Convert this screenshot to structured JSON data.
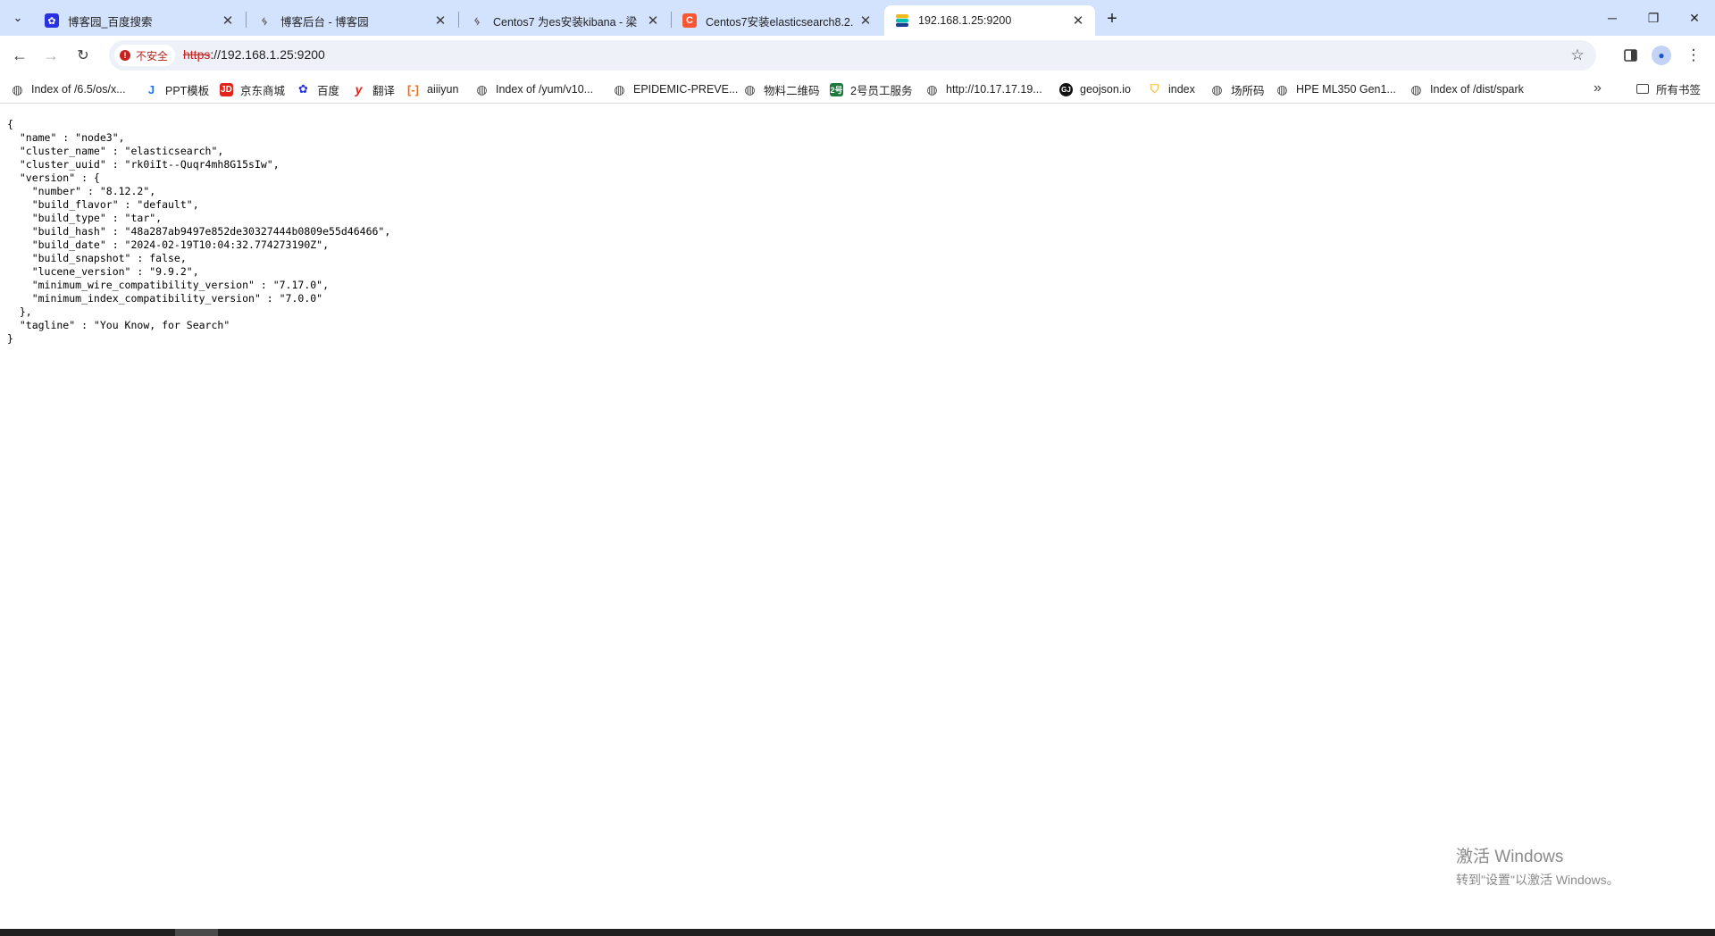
{
  "tabs": [
    {
      "title": "博客园_百度搜索",
      "icon": "baidu-paw-icon",
      "color": "#2932e1"
    },
    {
      "title": "博客后台 - 博客园",
      "icon": "cnblogs-icon",
      "color": "#555555"
    },
    {
      "title": "Centos7 为es安装kibana - 梁",
      "icon": "cnblogs-icon",
      "color": "#555555"
    },
    {
      "title": "Centos7安装elasticsearch8.2.",
      "icon": "csdn-icon",
      "color": "#fc5531"
    },
    {
      "title": "192.168.1.25:9200",
      "icon": "elastic-icon",
      "color": "#00bfb3"
    }
  ],
  "omnibox": {
    "security_label": "不安全",
    "url_scheme": "https",
    "url_rest": "://192.168.1.25:9200"
  },
  "bookmarks": [
    {
      "label": "Index of /6.5/os/x...",
      "icon": "globe-icon"
    },
    {
      "label": "PPT模板",
      "icon": "ppt-icon",
      "color": "#1677ff"
    },
    {
      "label": "京东商城",
      "icon": "jd-icon",
      "color": "#e1251b"
    },
    {
      "label": "百度",
      "icon": "baidu-paw-icon",
      "color": "#2932e1"
    },
    {
      "label": "翻译",
      "icon": "youdao-icon",
      "color": "#e1251b"
    },
    {
      "label": "aiiiyun",
      "icon": "aliyun-icon",
      "color": "#ff6a00"
    },
    {
      "label": "Index of /yum/v10...",
      "icon": "globe-icon"
    },
    {
      "label": "EPIDEMIC-PREVE...",
      "icon": "globe-icon"
    },
    {
      "label": "物料二维码",
      "icon": "globe-icon"
    },
    {
      "label": "2号员工服务",
      "icon": "two-icon",
      "color": "#1e7a3c"
    },
    {
      "label": "http://10.17.17.19...",
      "icon": "globe-icon"
    },
    {
      "label": "geojson.io",
      "icon": "geojson-icon",
      "color": "#111111"
    },
    {
      "label": "index",
      "icon": "shield-icon",
      "color": "#f5c242"
    },
    {
      "label": "场所码",
      "icon": "globe-icon"
    },
    {
      "label": "HPE ML350 Gen1...",
      "icon": "globe-icon"
    },
    {
      "label": "Index of /dist/spark",
      "icon": "globe-icon"
    }
  ],
  "bookmarks_folder": "所有书签",
  "json_body": "{\n  \"name\" : \"node3\",\n  \"cluster_name\" : \"elasticsearch\",\n  \"cluster_uuid\" : \"rk0iIt--Quqr4mh8G15sIw\",\n  \"version\" : {\n    \"number\" : \"8.12.2\",\n    \"build_flavor\" : \"default\",\n    \"build_type\" : \"tar\",\n    \"build_hash\" : \"48a287ab9497e852de30327444b0809e55d46466\",\n    \"build_date\" : \"2024-02-19T10:04:32.774273190Z\",\n    \"build_snapshot\" : false,\n    \"lucene_version\" : \"9.9.2\",\n    \"minimum_wire_compatibility_version\" : \"7.17.0\",\n    \"minimum_index_compatibility_version\" : \"7.0.0\"\n  },\n  \"tagline\" : \"You Know, for Search\"\n}",
  "watermark": {
    "line1": "激活 Windows",
    "line2": "转到\"设置\"以激活 Windows。"
  }
}
